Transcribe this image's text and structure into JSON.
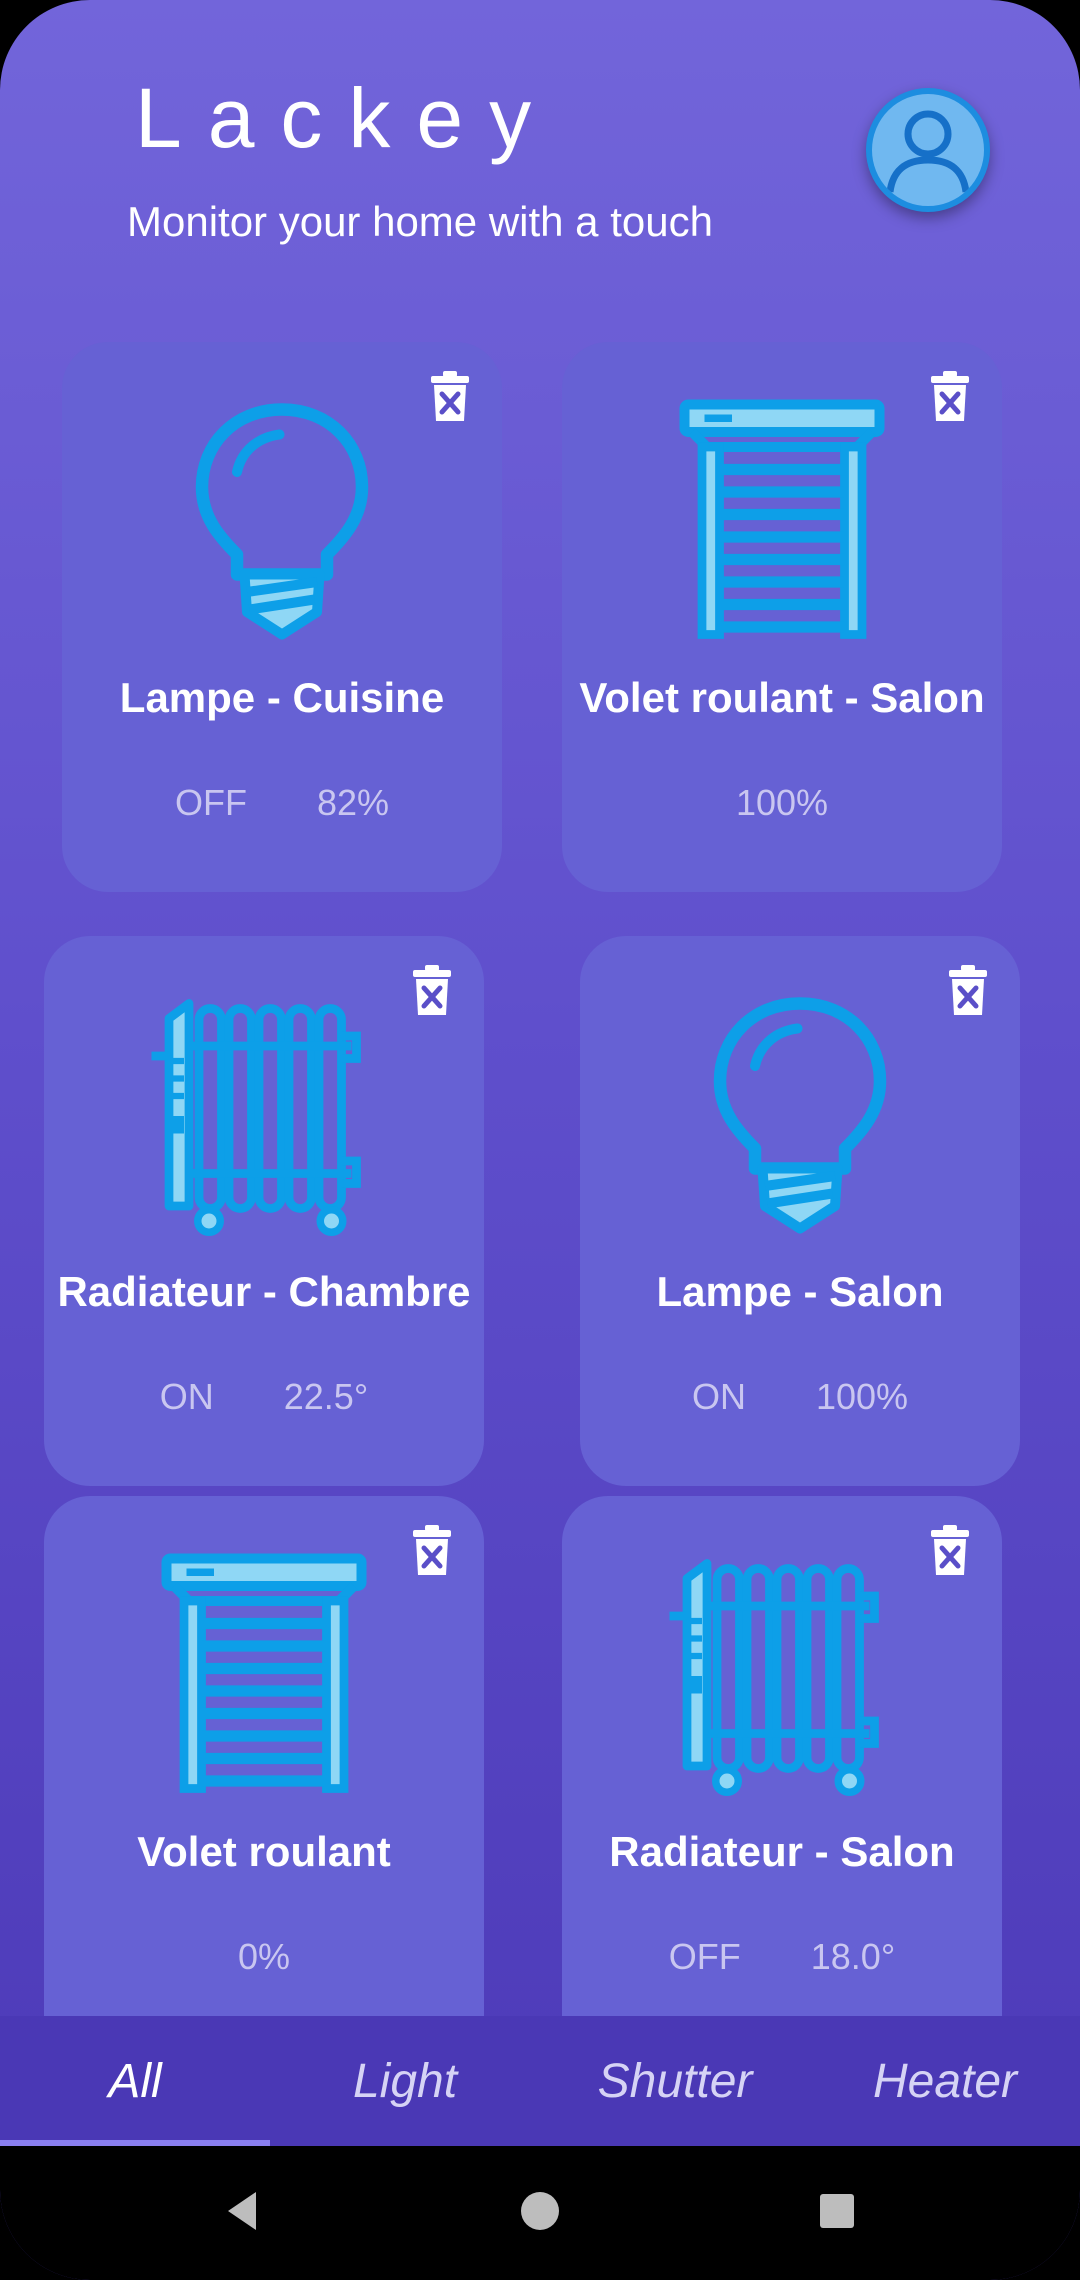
{
  "header": {
    "title": "Lackey",
    "subtitle": "Monitor your home with a touch",
    "avatar_icon": "user-avatar-icon"
  },
  "devices": [
    {
      "name": "Lampe - Cuisine",
      "type": "light",
      "icon": "lightbulb-icon",
      "stats": [
        "OFF",
        "82%"
      ]
    },
    {
      "name": "Volet roulant - Salon",
      "type": "shutter",
      "icon": "shutter-icon",
      "stats": [
        "100%"
      ]
    },
    {
      "name": "Radiateur - Chambre",
      "type": "heater",
      "icon": "radiator-icon",
      "stats": [
        "ON",
        "22.5°"
      ]
    },
    {
      "name": "Lampe - Salon",
      "type": "light",
      "icon": "lightbulb-icon",
      "stats": [
        "ON",
        "100%"
      ]
    },
    {
      "name": "Volet roulant",
      "type": "shutter",
      "icon": "shutter-icon",
      "stats": [
        "0%"
      ]
    },
    {
      "name": "Radiateur - Salon",
      "type": "heater",
      "icon": "radiator-icon",
      "stats": [
        "OFF",
        "18.0°"
      ]
    }
  ],
  "delete_icon": "trash-icon",
  "tabs": [
    {
      "label": "All",
      "active": true
    },
    {
      "label": "Light",
      "active": false
    },
    {
      "label": "Shutter",
      "active": false
    },
    {
      "label": "Heater",
      "active": false
    }
  ],
  "navbar": {
    "icons": [
      "back-icon",
      "home-icon",
      "recents-icon"
    ]
  },
  "colors": {
    "background_top": "#7265da",
    "background_bottom": "#4b38b6",
    "card": "#6661d4",
    "icon_blue": "#0d9fe8",
    "icon_light": "#8fd7f5"
  }
}
